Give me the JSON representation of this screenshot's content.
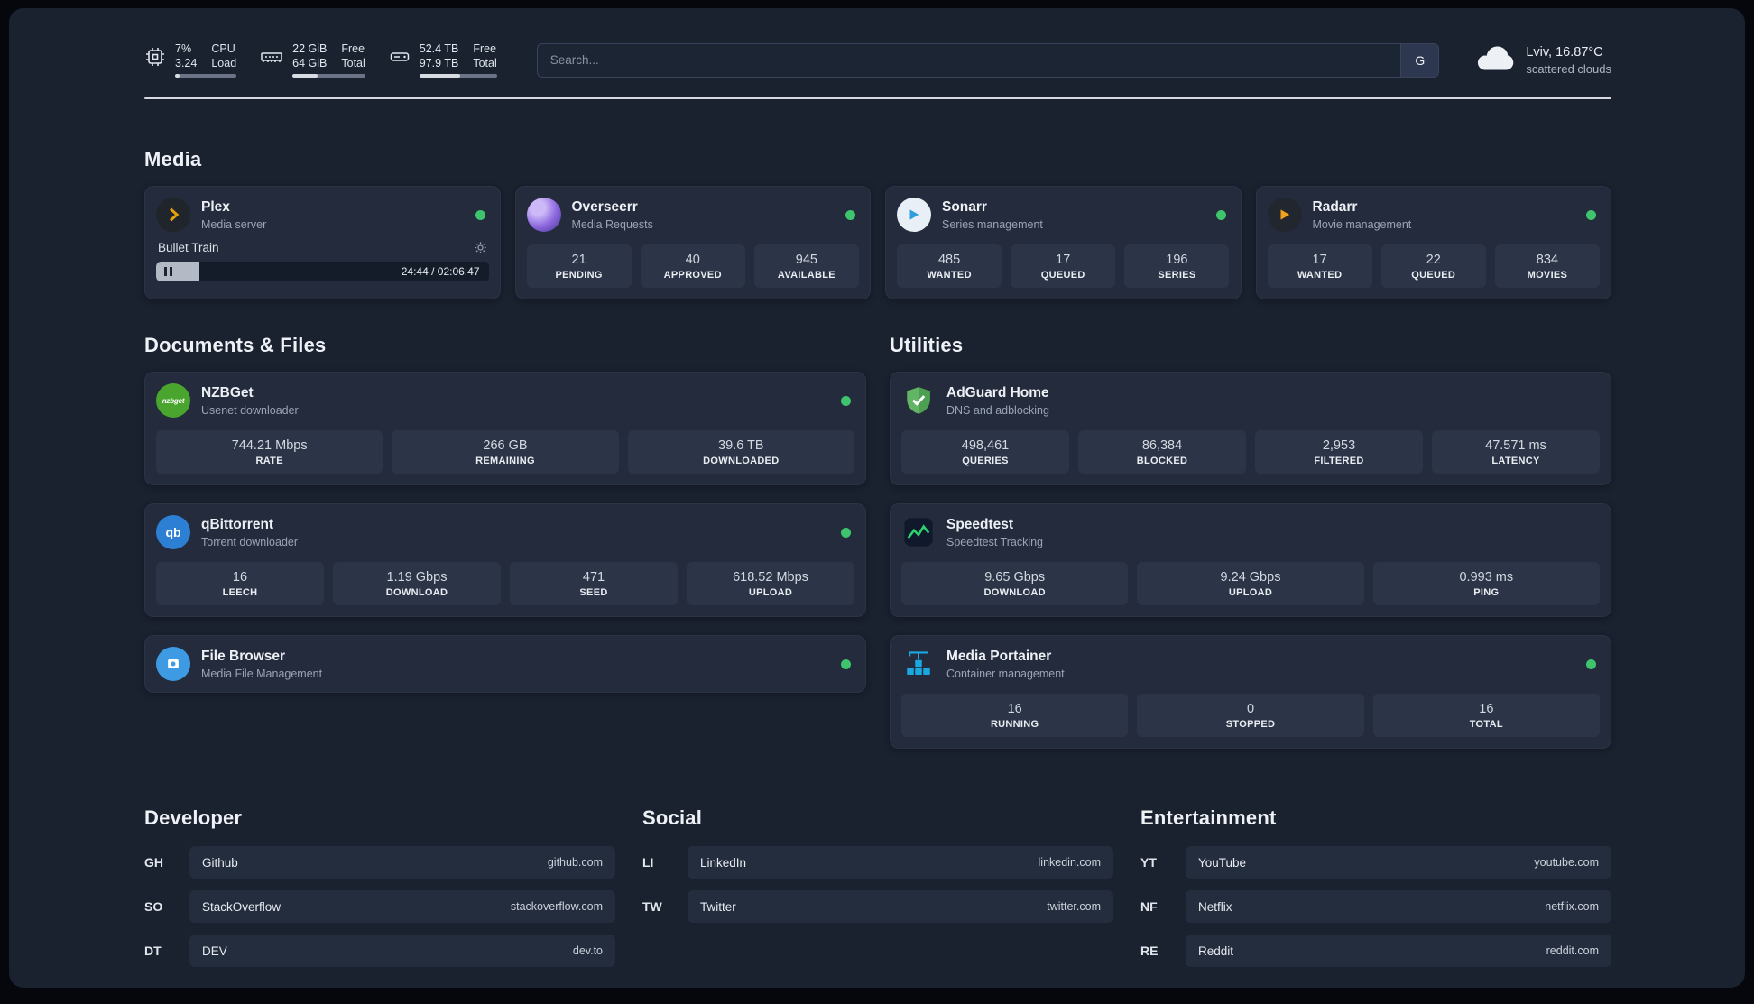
{
  "topbar": {
    "cpu": {
      "value1": "7%",
      "value2": "3.24",
      "label1": "CPU",
      "label2": "Load",
      "progress_pct": 7
    },
    "ram": {
      "value1": "22 GiB",
      "value2": "64 GiB",
      "label1": "Free",
      "label2": "Total",
      "progress_pct": 34
    },
    "disk": {
      "value1": "52.4 TB",
      "value2": "97.9 TB",
      "label1": "Free",
      "label2": "Total",
      "progress_pct": 53
    },
    "search": {
      "placeholder": "Search...",
      "engine_button": "G"
    },
    "weather": {
      "location": "Lviv, 16.87°C",
      "condition": "scattered clouds"
    }
  },
  "sections": {
    "media": {
      "title": "Media",
      "cards": [
        {
          "name": "Plex",
          "subtitle": "Media server",
          "status": "online",
          "player": {
            "track": "Bullet Train",
            "time": "24:44 / 02:06:47",
            "progress_pct": 13
          }
        },
        {
          "name": "Overseerr",
          "subtitle": "Media Requests",
          "status": "online",
          "stats": [
            {
              "value": "21",
              "label": "PENDING"
            },
            {
              "value": "40",
              "label": "APPROVED"
            },
            {
              "value": "945",
              "label": "AVAILABLE"
            }
          ]
        },
        {
          "name": "Sonarr",
          "subtitle": "Series management",
          "status": "online",
          "stats": [
            {
              "value": "485",
              "label": "WANTED"
            },
            {
              "value": "17",
              "label": "QUEUED"
            },
            {
              "value": "196",
              "label": "SERIES"
            }
          ]
        },
        {
          "name": "Radarr",
          "subtitle": "Movie management",
          "status": "online",
          "stats": [
            {
              "value": "17",
              "label": "WANTED"
            },
            {
              "value": "22",
              "label": "QUEUED"
            },
            {
              "value": "834",
              "label": "MOVIES"
            }
          ]
        }
      ]
    },
    "documents": {
      "title": "Documents & Files",
      "cards": [
        {
          "name": "NZBGet",
          "subtitle": "Usenet downloader",
          "status": "online",
          "icon_text": "nzbget",
          "stats": [
            {
              "value": "744.21 Mbps",
              "label": "RATE"
            },
            {
              "value": "266 GB",
              "label": "REMAINING"
            },
            {
              "value": "39.6 TB",
              "label": "DOWNLOADED"
            }
          ]
        },
        {
          "name": "qBittorrent",
          "subtitle": "Torrent downloader",
          "status": "online",
          "icon_text": "qb",
          "stats": [
            {
              "value": "16",
              "label": "LEECH"
            },
            {
              "value": "1.19 Gbps",
              "label": "DOWNLOAD"
            },
            {
              "value": "471",
              "label": "SEED"
            },
            {
              "value": "618.52 Mbps",
              "label": "UPLOAD"
            }
          ]
        },
        {
          "name": "File Browser",
          "subtitle": "Media File Management",
          "status": "online"
        }
      ]
    },
    "utilities": {
      "title": "Utilities",
      "cards": [
        {
          "name": "AdGuard Home",
          "subtitle": "DNS and adblocking",
          "stats": [
            {
              "value": "498,461",
              "label": "QUERIES"
            },
            {
              "value": "86,384",
              "label": "BLOCKED"
            },
            {
              "value": "2,953",
              "label": "FILTERED"
            },
            {
              "value": "47.571 ms",
              "label": "LATENCY"
            }
          ]
        },
        {
          "name": "Speedtest",
          "subtitle": "Speedtest Tracking",
          "stats": [
            {
              "value": "9.65 Gbps",
              "label": "DOWNLOAD"
            },
            {
              "value": "9.24 Gbps",
              "label": "UPLOAD"
            },
            {
              "value": "0.993 ms",
              "label": "PING"
            }
          ]
        },
        {
          "name": "Media Portainer",
          "subtitle": "Container management",
          "status": "online",
          "stats": [
            {
              "value": "16",
              "label": "RUNNING"
            },
            {
              "value": "0",
              "label": "STOPPED"
            },
            {
              "value": "16",
              "label": "TOTAL"
            }
          ]
        }
      ]
    }
  },
  "bookmarks": [
    {
      "title": "Developer",
      "items": [
        {
          "abbr": "GH",
          "name": "Github",
          "url": "github.com"
        },
        {
          "abbr": "SO",
          "name": "StackOverflow",
          "url": "stackoverflow.com"
        },
        {
          "abbr": "DT",
          "name": "DEV",
          "url": "dev.to"
        }
      ]
    },
    {
      "title": "Social",
      "items": [
        {
          "abbr": "LI",
          "name": "LinkedIn",
          "url": "linkedin.com"
        },
        {
          "abbr": "TW",
          "name": "Twitter",
          "url": "twitter.com"
        }
      ]
    },
    {
      "title": "Entertainment",
      "items": [
        {
          "abbr": "YT",
          "name": "YouTube",
          "url": "youtube.com"
        },
        {
          "abbr": "NF",
          "name": "Netflix",
          "url": "netflix.com"
        },
        {
          "abbr": "RE",
          "name": "Reddit",
          "url": "reddit.com"
        }
      ]
    }
  ],
  "colors": {
    "status_online": "#3ec46d",
    "accent_green": "#2dd36f"
  }
}
